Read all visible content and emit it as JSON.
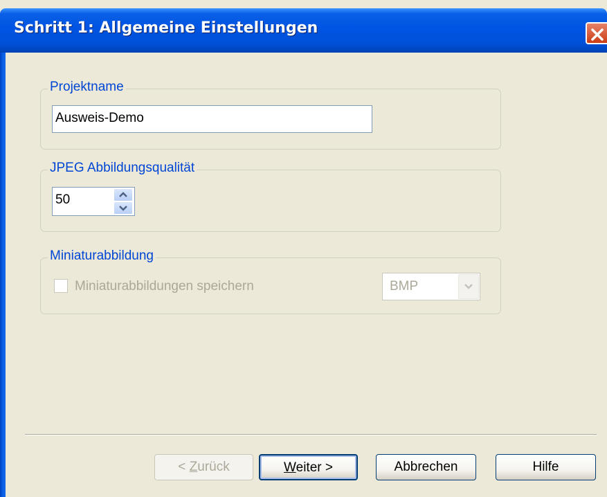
{
  "window": {
    "title": "Schritt 1: Allgemeine Einstellungen"
  },
  "project_group": {
    "legend": "Projektname",
    "value": "Ausweis-Demo"
  },
  "jpeg_group": {
    "legend": "JPEG Abbildungsqualität",
    "value": "50"
  },
  "thumbnail_group": {
    "legend": "Miniaturabbildung",
    "checkbox_label": "Miniaturabbildungen speichern",
    "checkbox_checked": false,
    "format_value": "BMP"
  },
  "buttons": {
    "back_prefix": "< ",
    "back_accel": "Z",
    "back_rest": "urück",
    "next_accel": "W",
    "next_rest": "eiter >",
    "cancel": "Abbrechen",
    "help": "Hilfe"
  },
  "colors": {
    "titlebar": "#0054e3",
    "face": "#ece9d8",
    "legend_text": "#0046d5"
  },
  "icons": {
    "close": "close-icon",
    "spin_up": "arrow-up-icon",
    "spin_down": "arrow-down-icon",
    "dropdown": "chevron-down-icon"
  }
}
